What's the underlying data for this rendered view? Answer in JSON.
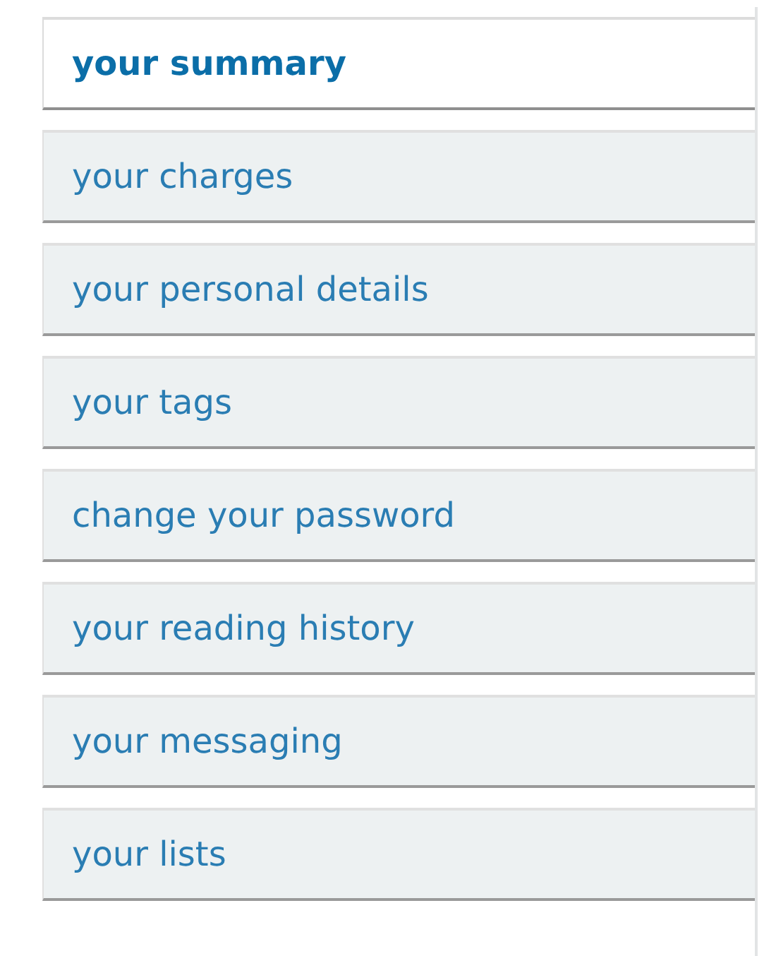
{
  "menu": [
    {
      "label": "your summary",
      "selected": true
    },
    {
      "label": "your charges",
      "selected": false
    },
    {
      "label": "your personal details",
      "selected": false
    },
    {
      "label": "your tags",
      "selected": false
    },
    {
      "label": "change your password",
      "selected": false
    },
    {
      "label": "your reading history",
      "selected": false
    },
    {
      "label": "your messaging",
      "selected": false
    },
    {
      "label": "your lists",
      "selected": false
    }
  ]
}
